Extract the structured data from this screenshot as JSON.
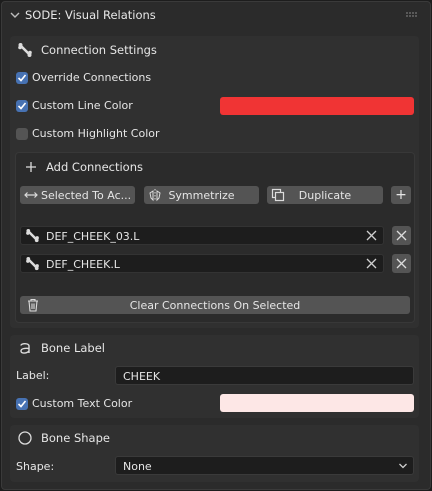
{
  "panel": {
    "title": "SODE: Visual Relations"
  },
  "connection_settings": {
    "title": "Connection Settings",
    "override_connections": {
      "label": "Override Connections",
      "checked": true
    },
    "custom_line_color": {
      "label": "Custom Line Color",
      "checked": true,
      "color": "#f03434"
    },
    "custom_highlight_color": {
      "label": "Custom Highlight Color",
      "checked": false
    },
    "add_connections": {
      "title": "Add Connections",
      "selected_to_active_label": "Selected To Ac...",
      "symmetrize_label": "Symmetrize",
      "duplicate_label": "Duplicate",
      "add_label": "+"
    },
    "connections": [
      {
        "name": "DEF_CHEEK_03.L"
      },
      {
        "name": "DEF_CHEEK.L"
      }
    ],
    "clear_label": "Clear Connections On Selected"
  },
  "bone_label": {
    "title": "Bone Label",
    "label_caption": "Label:",
    "label_value": "CHEEK",
    "custom_text_color": {
      "label": "Custom Text Color",
      "checked": true,
      "color": "#fde7e6"
    }
  },
  "bone_shape": {
    "title": "Bone Shape",
    "shape_caption": "Shape:",
    "shape_value": "None"
  },
  "colors": {
    "accent": "#4772b3",
    "panel_bg": "#2b2b2b",
    "button_bg": "#545454"
  }
}
